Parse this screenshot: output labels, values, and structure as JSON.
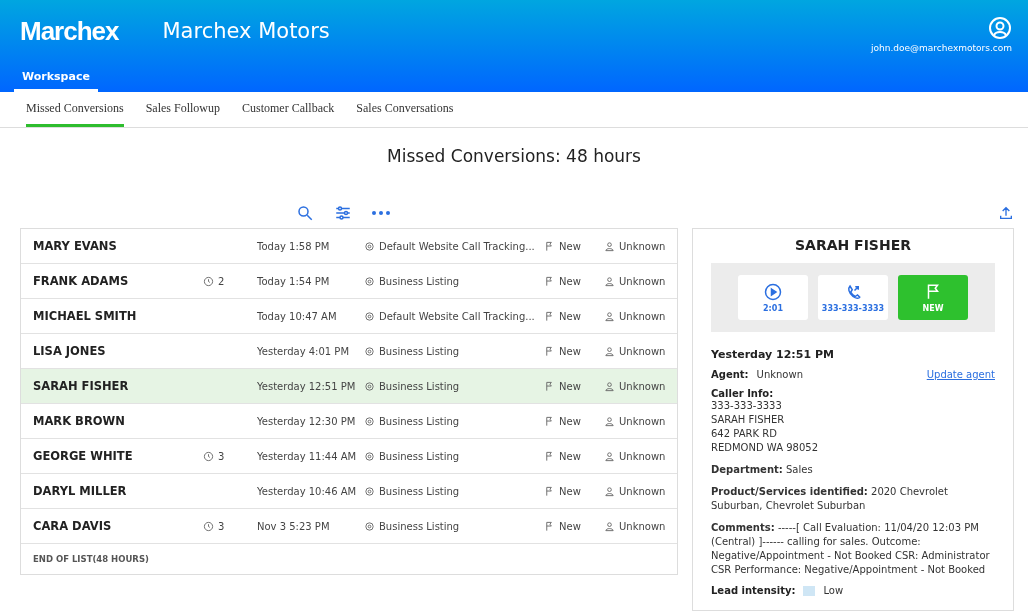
{
  "header": {
    "logo": "Marchex",
    "title": "Marchex Motors",
    "user_email": "john.doe@marchexmotors.com",
    "nav_tabs": [
      {
        "label": "Workspace",
        "selected": true
      }
    ]
  },
  "tabs": [
    {
      "label": "Missed Conversions",
      "selected": true
    },
    {
      "label": "Sales Followup",
      "selected": false
    },
    {
      "label": "Customer Callback",
      "selected": false
    },
    {
      "label": "Sales Conversations",
      "selected": false
    }
  ],
  "page_title": "Missed Conversions: 48 hours",
  "calls": [
    {
      "name": "MARY EVANS",
      "time": "Today 1:58 PM",
      "source": "Default Website Call Tracking...",
      "status": "New",
      "agent": "Unknown",
      "selected": false
    },
    {
      "name": "FRANK ADAMS",
      "callbacks": "2",
      "time": "Today 1:54 PM",
      "source": "Business Listing",
      "status": "New",
      "agent": "Unknown",
      "selected": false
    },
    {
      "name": "MICHAEL SMITH",
      "time": "Today 10:47 AM",
      "source": "Default Website Call Tracking...",
      "status": "New",
      "agent": "Unknown",
      "selected": false
    },
    {
      "name": "LISA JONES",
      "time": "Yesterday 4:01 PM",
      "source": "Business Listing",
      "status": "New",
      "agent": "Unknown",
      "selected": false
    },
    {
      "name": "SARAH FISHER",
      "time": "Yesterday 12:51 PM",
      "source": "Business Listing",
      "status": "New",
      "agent": "Unknown",
      "selected": true
    },
    {
      "name": "MARK BROWN",
      "time": "Yesterday 12:30 PM",
      "source": "Business Listing",
      "status": "New",
      "agent": "Unknown",
      "selected": false
    },
    {
      "name": "GEORGE WHITE",
      "callbacks": "3",
      "time": "Yesterday 11:44 AM",
      "source": "Business Listing",
      "status": "New",
      "agent": "Unknown",
      "selected": false
    },
    {
      "name": "DARYL MILLER",
      "time": "Yesterday 10:46 AM",
      "source": "Business Listing",
      "status": "New",
      "agent": "Unknown",
      "selected": false
    },
    {
      "name": "CARA DAVIS",
      "callbacks": "3",
      "time": "Nov 3 5:23 PM",
      "source": "Business Listing",
      "status": "New",
      "agent": "Unknown",
      "selected": false
    }
  ],
  "list_footer": "END OF LIST(48 HOURS)",
  "detail": {
    "name": "SARAH FISHER",
    "actions": [
      {
        "kind": "play",
        "label": "2:01"
      },
      {
        "kind": "phone",
        "label": "333-333-3333"
      },
      {
        "kind": "status",
        "label": "NEW"
      }
    ],
    "time": "Yesterday 12:51 PM",
    "agent_label": "Agent:",
    "agent": "Unknown",
    "update_link": "Update agent",
    "caller_label": "Caller Info:",
    "caller_lines": [
      "333-333-3333",
      "SARAH FISHER",
      "642 PARK RD",
      "REDMOND WA 98052"
    ],
    "fields": [
      {
        "label": "Department:",
        "value": "Sales"
      },
      {
        "label": "Product/Services identified:",
        "value": "2020 Chevrolet Suburban, Chevrolet Suburban"
      },
      {
        "label": "Comments:",
        "value": "-----[ Call Evaluation: 11/04/20 12:03 PM (Central) ]------ calling for sales. Outcome: Negative/Appointment - Not Booked CSR: Administrator CSR Performance: Negative/Appointment - Not Booked"
      }
    ],
    "lead_label": "Lead intensity:",
    "lead_value": "Low"
  }
}
